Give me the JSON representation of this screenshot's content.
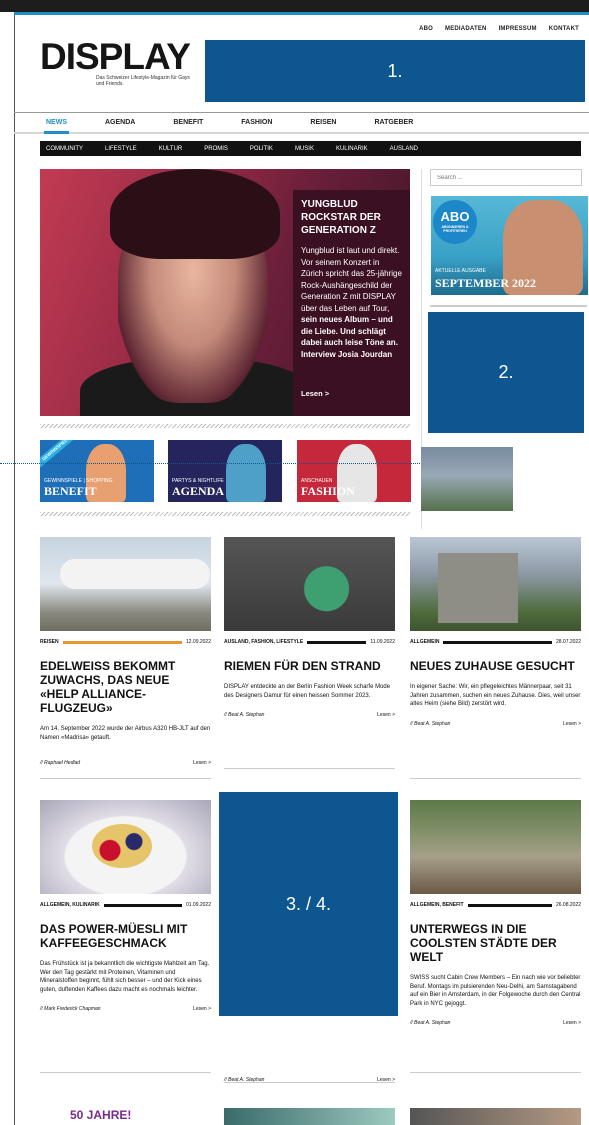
{
  "utility_nav": [
    "ABO",
    "MEDIADATEN",
    "IMPRESSUM",
    "KONTAKT"
  ],
  "logo": "DISPLAY",
  "tagline": "Das Schweizer Lifestyle-Magazin für Gays und Friends.",
  "placeholders": [
    "1.",
    "2.",
    "3. / 4."
  ],
  "main_nav": [
    "NEWS",
    "AGENDA",
    "BENEFIT",
    "FASHION",
    "REISEN",
    "RATGEBER"
  ],
  "sub_nav": [
    "COMMUNITY",
    "LIFESTYLE",
    "KULTUR",
    "PROMIS",
    "POLITIK",
    "MUSIK",
    "KULINARIK",
    "AUSLAND"
  ],
  "hero": {
    "title": "YUNGBLUD ROCKSTAR DER GENERATION Z",
    "text_plain": "Yungblud ist laut und direkt. Vor seinem Konzert in Zürich spricht das 25-jährige Rock-Aushängeschild der Generation Z mit DISPLAY über das Leben auf Tour,",
    "text_bold": "sein neues Album – und die Liebe. Und schlägt dabei auch leise Töne an. Interview Josia Jourdan",
    "more": "Lesen >"
  },
  "promos": [
    {
      "ribbon": "GEWINNSPIEL",
      "sub": "GEWINNSPIELE | SHOPPING",
      "big": "BENEFIT",
      "color": "#2b7fc4"
    },
    {
      "ribbon": "",
      "sub": "PARTYS & NIGHTLIFE",
      "big": "AGENDA",
      "color": "#2a2a6a"
    },
    {
      "ribbon": "",
      "sub": "ANSCHAUEN",
      "big": "FASHION",
      "color": "#c8283a"
    }
  ],
  "sidebar": {
    "search_placeholder": "Search ...",
    "abo_title": "ABO",
    "abo_sub": "ABONNIEREN & PROFITIEREN",
    "abo_issue": "AKTUELLE AUSGABE",
    "abo_month": "SEPTEMBER 2022"
  },
  "articles": [
    {
      "category": "REISEN",
      "date": "12.09.2022",
      "title": "EDELWEISS BEKOMMT ZUWACHS, DAS NEUE «HELP ALLIANCE-FLUGZEUG»",
      "text": "Am 14. September 2022 wurde der Airbus A320 HB-JLT auf den Namen «Madrisa» getauft.",
      "author": "// Raphael Hedlad",
      "more": "Lesen >"
    },
    {
      "category": "AUSLAND, FASHION, LIFESTYLE",
      "date": "11.09.2022",
      "title": "RIEMEN FÜR DEN STRAND",
      "text": "DISPLAY entdeckte an der Berlin Fashion Week scharfe Mode des Designers Damur für einen heissen Sommer 2023.",
      "author": "// Beat A. Stephan",
      "more": "Lesen >"
    },
    {
      "category": "ALLGEMEIN",
      "date": "28.07.2022",
      "title": "NEUES ZUHAUSE GESUCHT",
      "text": "In eigener Sache: Wir, ein pflegeleichtes Männerpaar, seit 31 Jahren zusammen, suchen ein neues Zuhause. Dies, weil unser altes Heim (siehe Bild) zerstört wird.",
      "author": "// Beat A. Stephan",
      "more": "Lesen >"
    },
    {
      "category": "ALLGEMEIN, KULINARIK",
      "date": "01.09.2022",
      "title": "DAS POWER-MÜESLI MIT KAFFEEGESCHMACK",
      "text": "Das Frühstück ist ja bekanntlich die wichtigste Mahlzeit am Tag. Wer den Tag gestärkt mit Proteinen, Vitaminen und Mineralstoffen beginnt, fühlt sich besser – und der Kick eines guten, duftenden Kaffees dazu macht es nochmals leichter.",
      "author": "// Mark Frederick Chapman",
      "more": "Lesen >"
    },
    {
      "category": "",
      "date": "",
      "title": "",
      "text": "",
      "author": "// Beat A. Stephan",
      "more": "Lesen >"
    },
    {
      "category": "ALLGEMEIN, BENEFIT",
      "date": "26.08.2022",
      "title": "UNTERWEGS IN DIE COOLSTEN STÄDTE DER WELT",
      "text": "SWISS sucht Cabin Crew Members – Ein nach wie vor beliebter Beruf. Montags im pulsierenden Neu-Delhi, am Samstagabend auf ein Bier in Amsterdam, in der Folgewoche durch den Central Park in NYC gejoggt.",
      "author": "// Beat A. Stephan",
      "more": "Lesen >"
    }
  ],
  "bottom_teaser": "50 JAHRE!"
}
